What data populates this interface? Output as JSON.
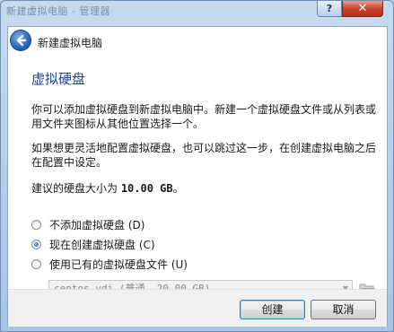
{
  "window": {
    "title": "新建虚拟电脑 - 管理器",
    "help_label": "?",
    "close_label": "✕"
  },
  "header": {
    "back_icon": "back-arrow-icon",
    "title": "新建虚拟电脑"
  },
  "main": {
    "page_title": "虚拟硬盘",
    "paragraph1": "你可以添加虚拟硬盘到新虚拟电脑中。新建一个虚拟硬盘文件或从列表或用文件夹图标从其他位置选择一个。",
    "paragraph2": "如果想更灵活地配置虚拟硬盘，也可以跳过这一步，在创建虚拟电脑之后在配置中设定。",
    "size_prefix": "建议的硬盘大小为 ",
    "size_value": "10.00 GB",
    "size_suffix": "。",
    "options": [
      {
        "label": "不添加虚拟硬盘 (D)",
        "checked": false
      },
      {
        "label": "现在创建虚拟硬盘 (C)",
        "checked": true
      },
      {
        "label": "使用已有的虚拟硬盘文件 (U)",
        "checked": false
      }
    ],
    "disk_select_value": "centos.vdi (普通, 20.00 GB)",
    "folder_icon": "folder-icon"
  },
  "footer": {
    "create_label": "创建",
    "cancel_label": "取消"
  }
}
